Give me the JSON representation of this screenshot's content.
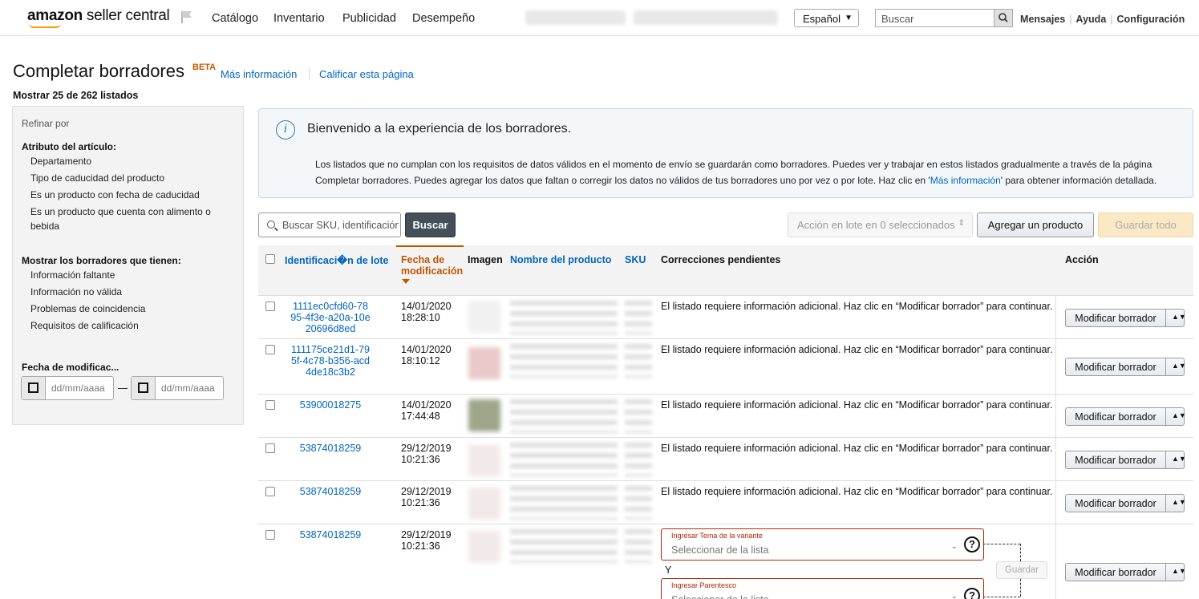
{
  "header": {
    "logo_bold": "amazon",
    "logo_light": " seller central",
    "nav": [
      "Catálogo",
      "Inventario",
      "Publicidad",
      "Desempeño"
    ],
    "language": "Español",
    "search_placeholder": "Buscar",
    "links": [
      "Mensajes",
      "Ayuda",
      "Configuración"
    ]
  },
  "page": {
    "title": "Completar borradores",
    "badge": "BETA",
    "link_more_info": "Más información",
    "link_rate": "Calificar esta página",
    "count_text": "Mostrar 25 de 262 listados"
  },
  "sidebar": {
    "heading": "Refinar por",
    "section1": "Atributo del artículo:",
    "attrs": [
      "Departamento",
      "Tipo de caducidad del producto",
      "Es un producto con fecha de caducidad",
      "Es un producto que cuenta con alimento o bebida"
    ],
    "section2": "Mostrar los borradores que tienen:",
    "filters": [
      "Información faltante",
      "Información no válida",
      "Problemas de coincidencia",
      "Requisitos de calificación"
    ],
    "section3": "Fecha de modificac...",
    "date_placeholder": "dd/mm/aaaa"
  },
  "info": {
    "title": "Bienvenido a la experiencia de los borradores.",
    "body_1": "Los listados que no cumplan con los requisitos de datos válidos en el momento de envío se guardarán como borradores. Puedes ver y trabajar en estos listados gradualmente a través de la página Completar borradores. Puedes agregar los datos que faltan o corregir los datos no válidos de tus borradores uno por vez o por lote. Haz clic en '",
    "body_link": "Más información",
    "body_2": "' para obtener información detallada."
  },
  "toolbar": {
    "search_placeholder": "Buscar SKU, identificación",
    "search_button": "Buscar",
    "batch_action": "Acción en lote en 0 seleccionados",
    "add_product": "Agregar un producto",
    "save_all": "Guardar todo"
  },
  "table": {
    "headers": {
      "batch_id": "Identificaci�n de lote",
      "modified_date": "Fecha de modificación",
      "image": "Imagen",
      "product_name": "Nombre del producto",
      "sku": "SKU",
      "corrections": "Correcciones pendientes",
      "action": "Acción"
    },
    "rows": [
      {
        "id": "1111ec0cfd60-7895-4f3e-a20a-10e20696d8ed",
        "date": "14/01/2020",
        "time": "18:28:10",
        "correction": "El listado requiere información adicional. Haz clic en “Modificar borrador” para continuar."
      },
      {
        "id": "111175ce21d1-795f-4c78-b356-acd4de18c3b2",
        "date": "14/01/2020",
        "time": "18:10:12",
        "correction": "El listado requiere información adicional. Haz clic en “Modificar borrador” para continuar."
      },
      {
        "id": "53900018275",
        "date": "14/01/2020",
        "time": "17:44:48",
        "correction": "El listado requiere información adicional. Haz clic en “Modificar borrador” para continuar."
      },
      {
        "id": "53874018259",
        "date": "29/12/2019",
        "time": "10:21:36",
        "correction": "El listado requiere información adicional. Haz clic en “Modificar borrador” para continuar."
      },
      {
        "id": "53874018259",
        "date": "29/12/2019",
        "time": "10:21:36",
        "correction": "El listado requiere información adicional. Haz clic en “Modificar borrador” para continuar."
      },
      {
        "id": "53874018259",
        "date": "29/12/2019",
        "time": "10:21:36",
        "correction": ""
      }
    ],
    "modify_button": "Modificar borrador",
    "variant_theme_label": "Ingresar Tema de la variante",
    "variant_placeholder": "Seleccionar de la lista",
    "and_text": "Y",
    "parentage_label": "Ingresar Parentesco",
    "save_button": "Guardar"
  },
  "colors": {
    "link": "#0066c0",
    "accent_orange": "#c45500",
    "error_red": "#b12704",
    "info_bg": "#f3f7fa"
  }
}
